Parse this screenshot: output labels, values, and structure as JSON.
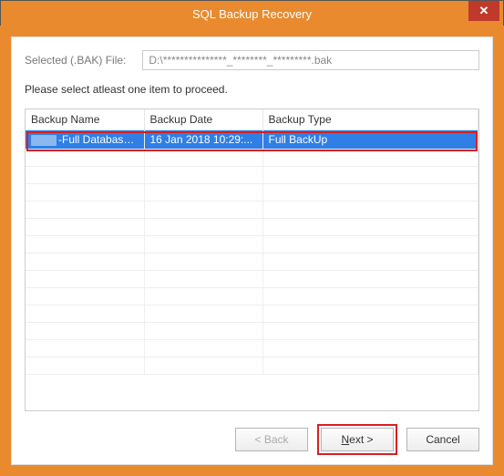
{
  "window": {
    "title": "SQL Backup Recovery",
    "close_symbol": "✕"
  },
  "file": {
    "label": "Selected (.BAK) File:",
    "value": "D:\\***************_********_*********.bak"
  },
  "instruction": "Please select atleast one item to proceed.",
  "grid": {
    "headers": {
      "c1": "Backup Name",
      "c2": "Backup Date",
      "c3": "Backup Type"
    },
    "row1": {
      "name": "-Full Database ...",
      "date": "16 Jan 2018 10:29:...",
      "type": "Full BackUp"
    }
  },
  "buttons": {
    "back": "< Back",
    "next_prefix": "N",
    "next_rest": "ext >",
    "cancel": "Cancel"
  }
}
